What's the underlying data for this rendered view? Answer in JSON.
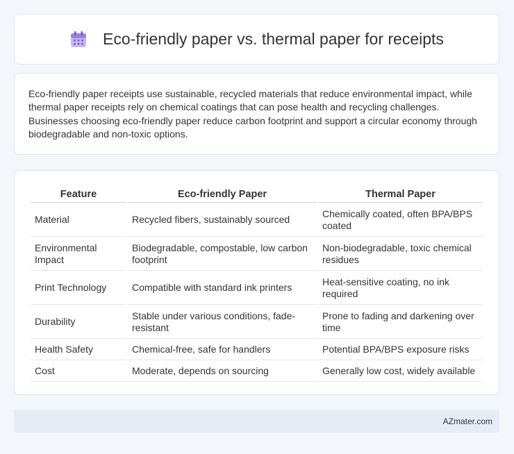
{
  "header": {
    "title": "Eco-friendly paper vs. thermal paper for receipts",
    "icon": "calendar-icon"
  },
  "intro": {
    "text": "Eco-friendly paper receipts use sustainable, recycled materials that reduce environmental impact, while thermal paper receipts rely on chemical coatings that can pose health and recycling challenges. Businesses choosing eco-friendly paper reduce carbon footprint and support a circular economy through biodegradable and non-toxic options."
  },
  "table": {
    "headers": [
      "Feature",
      "Eco-friendly Paper",
      "Thermal Paper"
    ],
    "rows": [
      [
        "Material",
        "Recycled fibers, sustainably sourced",
        "Chemically coated, often BPA/BPS coated"
      ],
      [
        "Environmental Impact",
        "Biodegradable, compostable, low carbon footprint",
        "Non-biodegradable, toxic chemical residues"
      ],
      [
        "Print Technology",
        "Compatible with standard ink printers",
        "Heat-sensitive coating, no ink required"
      ],
      [
        "Durability",
        "Stable under various conditions, fade-resistant",
        "Prone to fading and darkening over time"
      ],
      [
        "Health Safety",
        "Chemical-free, safe for handlers",
        "Potential BPA/BPS exposure risks"
      ],
      [
        "Cost",
        "Moderate, depends on sourcing",
        "Generally low cost, widely available"
      ]
    ]
  },
  "footer": {
    "brand": "AZmater.com"
  }
}
